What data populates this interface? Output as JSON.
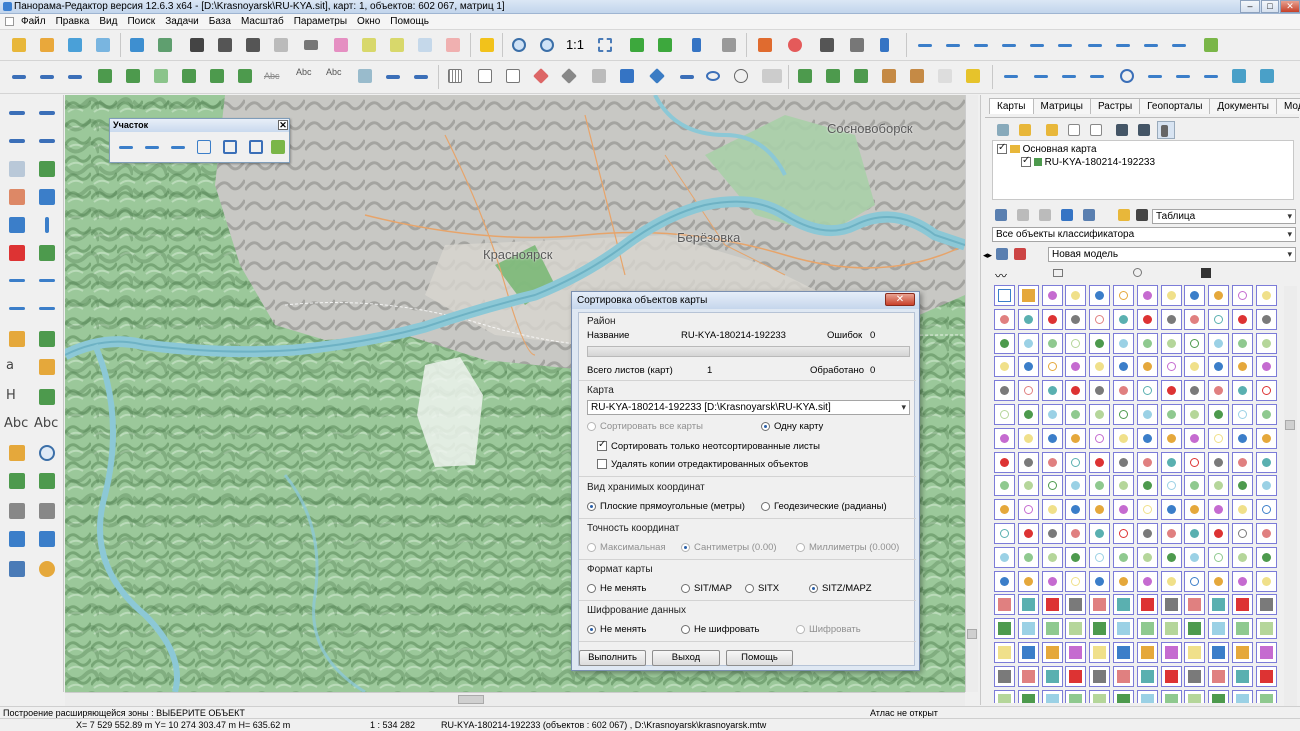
{
  "window": {
    "title": "Панорама-Редактор версия 12.6.3 x64 - [D:\\Krasnoyarsk\\RU-KYA.sit], карт: 1, объектов: 602 067, матриц 1]",
    "controls": [
      "–",
      "□",
      "✕"
    ]
  },
  "menu": [
    "Файл",
    "Правка",
    "Вид",
    "Поиск",
    "Задачи",
    "База",
    "Масштаб",
    "Параметры",
    "Окно",
    "Помощь"
  ],
  "toolbar": {
    "zoom_label": "1:1"
  },
  "left_tools": [
    "a",
    "H",
    "Abc",
    "Abc"
  ],
  "float_panel": {
    "title": "Участок",
    "close": "✕"
  },
  "map": {
    "labels": [
      {
        "text": "Сосновоборск"
      },
      {
        "text": "Красноярск"
      },
      {
        "text": "Берёзовка"
      }
    ]
  },
  "right_panel": {
    "tabs": [
      "Карты",
      "Матрицы",
      "Растры",
      "Геопорталы",
      "Документы",
      "Модели"
    ],
    "tree": {
      "root": "Основная карта",
      "child": "RU-KYA-180214-192233"
    },
    "view_combo": "Таблица",
    "filter_combo": "Все объекты классификатора",
    "model_combo": "Новая модель"
  },
  "dialog": {
    "title": "Сортировка объектов карты",
    "close": "✕",
    "region": {
      "header": "Район",
      "name_label": "Название",
      "name_value": "RU-KYA-180214-192233",
      "errors_label": "Ошибок",
      "errors_value": "0",
      "sheets_label": "Всего листов (карт)",
      "sheets_value": "1",
      "processed_label": "Обработано",
      "processed_value": "0",
      "progress": 0
    },
    "map": {
      "header": "Карта",
      "selected": "RU-KYA-180214-192233 [D:\\Krasnoyarsk\\RU-KYA.sit]",
      "all_maps": "Сортировать все карты",
      "one_map": "Одну карту",
      "only_unsorted": "Сортировать только неотсортированные листы",
      "delete_copies": "Удалять копии отредактированных объектов"
    },
    "coords": {
      "header": "Вид хранимых координат",
      "flat": "Плоские прямоугольные (метры)",
      "geo": "Геодезические (радианы)"
    },
    "precision": {
      "header": "Точность координат",
      "max": "Максимальная",
      "cm": "Сантиметры (0.00)",
      "mm": "Миллиметры (0.000)"
    },
    "format": {
      "header": "Формат карты",
      "keep": "Не менять",
      "sitmap": "SIT/MAP",
      "sitx": "SITX",
      "sitz": "SITZ/MAPZ"
    },
    "encryption": {
      "header": "Шифрование данных",
      "keep": "Не менять",
      "none": "Не шифровать",
      "encrypt": "Шифровать"
    },
    "buttons": {
      "run": "Выполнить",
      "exit": "Выход",
      "help": "Помощь"
    }
  },
  "status": {
    "message": "Построение расширяющейся зоны : ВЫБЕРИТЕ ОБЪЕКТ",
    "atlas": "Атлас не открыт",
    "coords": "X= 7 529 552.89 m  Y= 10 274 303.47 m  H=  635.62 m",
    "scale": "1 : 534 282",
    "info": "RU-KYA-180214-192233   (объектов : 602 067) ,  D:\\Krasnoyarsk\\krasnoyarsk.mtw"
  }
}
